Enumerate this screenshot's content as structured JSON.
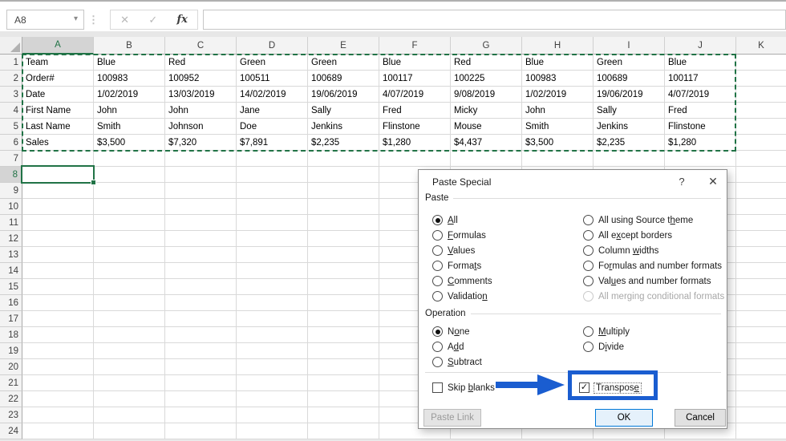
{
  "colors": {
    "excel_green": "#217346",
    "annotation_blue": "#1a5dd0",
    "ok_border_blue": "#0078d7"
  },
  "formula_bar": {
    "name_box_value": "A8",
    "dropdown_icon": "▾",
    "separator_icon": "⋮",
    "cancel_icon": "✕",
    "enter_icon": "✓",
    "fx_icon": "fx",
    "formula_value": ""
  },
  "grid": {
    "columns": [
      "A",
      "B",
      "C",
      "D",
      "E",
      "F",
      "G",
      "H",
      "I",
      "J",
      "K"
    ],
    "rows": [
      "1",
      "2",
      "3",
      "4",
      "5",
      "6",
      "7",
      "8",
      "9",
      "10",
      "11",
      "12",
      "13",
      "14",
      "15",
      "16",
      "17",
      "18",
      "19",
      "20",
      "21",
      "22",
      "23",
      "24"
    ],
    "selected_column": "A",
    "selected_row": "8",
    "selected_cell": "A8",
    "copied_range": "A1:J6",
    "data": [
      [
        "Team",
        "Blue",
        "Red",
        "Green",
        "Green",
        "Blue",
        "Red",
        "Blue",
        "Green",
        "Blue"
      ],
      [
        "Order#",
        "100983",
        "100952",
        "100511",
        "100689",
        "100117",
        "100225",
        "100983",
        "100689",
        "100117"
      ],
      [
        "Date",
        "1/02/2019",
        "13/03/2019",
        "14/02/2019",
        "19/06/2019",
        "4/07/2019",
        "9/08/2019",
        "1/02/2019",
        "19/06/2019",
        "4/07/2019"
      ],
      [
        "First Name",
        "John",
        "John",
        "Jane",
        "Sally",
        "Fred",
        "Micky",
        "John",
        "Sally",
        "Fred"
      ],
      [
        "Last Name",
        "Smith",
        "Johnson",
        "Doe",
        "Jenkins",
        "Flinstone",
        "Mouse",
        "Smith",
        "Jenkins",
        "Flinstone"
      ],
      [
        "Sales",
        "$3,500",
        "$7,320",
        "$7,891",
        "$2,235",
        "$1,280",
        "$4,437",
        "$3,500",
        "$2,235",
        "$1,280"
      ]
    ]
  },
  "dialog": {
    "title": "Paste Special",
    "help_icon": "?",
    "close_icon": "✕",
    "paste_group": {
      "label": "Paste",
      "left": [
        {
          "label": "All",
          "accel": 0,
          "selected": true
        },
        {
          "label": "Formulas",
          "accel": 0
        },
        {
          "label": "Values",
          "accel": 0
        },
        {
          "label": "Formats",
          "accel": 5
        },
        {
          "label": "Comments",
          "accel": 0
        },
        {
          "label": "Validation",
          "accel": 9
        }
      ],
      "right": [
        {
          "label": "All using Source theme",
          "accel": 18
        },
        {
          "label": "All except borders",
          "accel": 5
        },
        {
          "label": "Column widths",
          "accel": 7
        },
        {
          "label": "Formulas and number formats",
          "accel": 2
        },
        {
          "label": "Values and number formats",
          "accel": 3
        },
        {
          "label": "All merging conditional formats",
          "accel": -1,
          "disabled": true
        }
      ]
    },
    "operation_group": {
      "label": "Operation",
      "left": [
        {
          "label": "None",
          "accel": 1,
          "selected": true
        },
        {
          "label": "Add",
          "accel": 1
        },
        {
          "label": "Subtract",
          "accel": 0
        }
      ],
      "right": [
        {
          "label": "Multiply",
          "accel": 0
        },
        {
          "label": "Divide",
          "accel": 1
        }
      ]
    },
    "skip_blanks": {
      "label": "Skip blanks",
      "accel": 5,
      "checked": false
    },
    "transpose": {
      "label": "Transpose",
      "accel": 8,
      "checked": true
    },
    "buttons": {
      "paste_link": "Paste Link",
      "ok": "OK",
      "cancel": "Cancel"
    }
  }
}
